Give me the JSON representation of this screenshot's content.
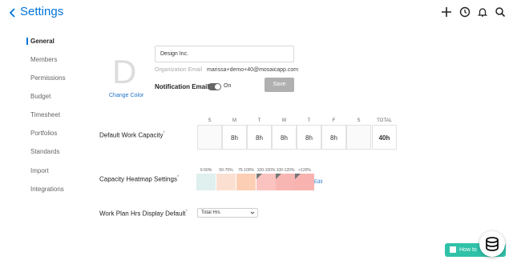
{
  "header": {
    "title": "Settings"
  },
  "sidebar": {
    "items": [
      {
        "label": "General",
        "active": true
      },
      {
        "label": "Members"
      },
      {
        "label": "Permissions"
      },
      {
        "label": "Budget"
      },
      {
        "label": "Timesheet"
      },
      {
        "label": "Portfolios"
      },
      {
        "label": "Standards"
      },
      {
        "label": "Import"
      },
      {
        "label": "Integrations"
      }
    ]
  },
  "org": {
    "logo_letter": "D",
    "change_color": "Change Color",
    "name": "Design Inc.",
    "email_label": "Organization Email",
    "email": "marissa+demo+40@mosaicapp.com",
    "notification_label": "Notification Email",
    "notification_state": "On",
    "save": "Save"
  },
  "work_capacity": {
    "label": "Default Work Capacity",
    "marker": "*",
    "days": [
      {
        "head": "S",
        "value": ""
      },
      {
        "head": "M",
        "value": "8h"
      },
      {
        "head": "T",
        "value": "8h"
      },
      {
        "head": "W",
        "value": "8h"
      },
      {
        "head": "T",
        "value": "8h"
      },
      {
        "head": "F",
        "value": "8h"
      },
      {
        "head": "S",
        "value": ""
      },
      {
        "head": "TOTAL",
        "value": "40h"
      }
    ]
  },
  "heatmap": {
    "label": "Capacity Heatmap Settings",
    "marker": "*",
    "edit": "Edit",
    "levels": [
      {
        "range": "0-50%",
        "color": "#dff0ee"
      },
      {
        "range": "50-75%",
        "color": "#fbe0d2"
      },
      {
        "range": "75-100%",
        "color": "#fccfb4"
      },
      {
        "range": "100-100%",
        "color": "#fbc3c0"
      },
      {
        "range": "100-120%",
        "color": "#f8b6b3"
      },
      {
        "range": ">120%",
        "color": "#f8b3b1"
      }
    ]
  },
  "workplan": {
    "label": "Work Plan Hrs Display Default",
    "marker": "*",
    "selected": "Total Hrs"
  },
  "help": {
    "how_to": "How to"
  },
  "colors": {
    "accent": "#0074d9",
    "help": "#2fc2a8",
    "save_disabled": "#b0b0b0"
  }
}
